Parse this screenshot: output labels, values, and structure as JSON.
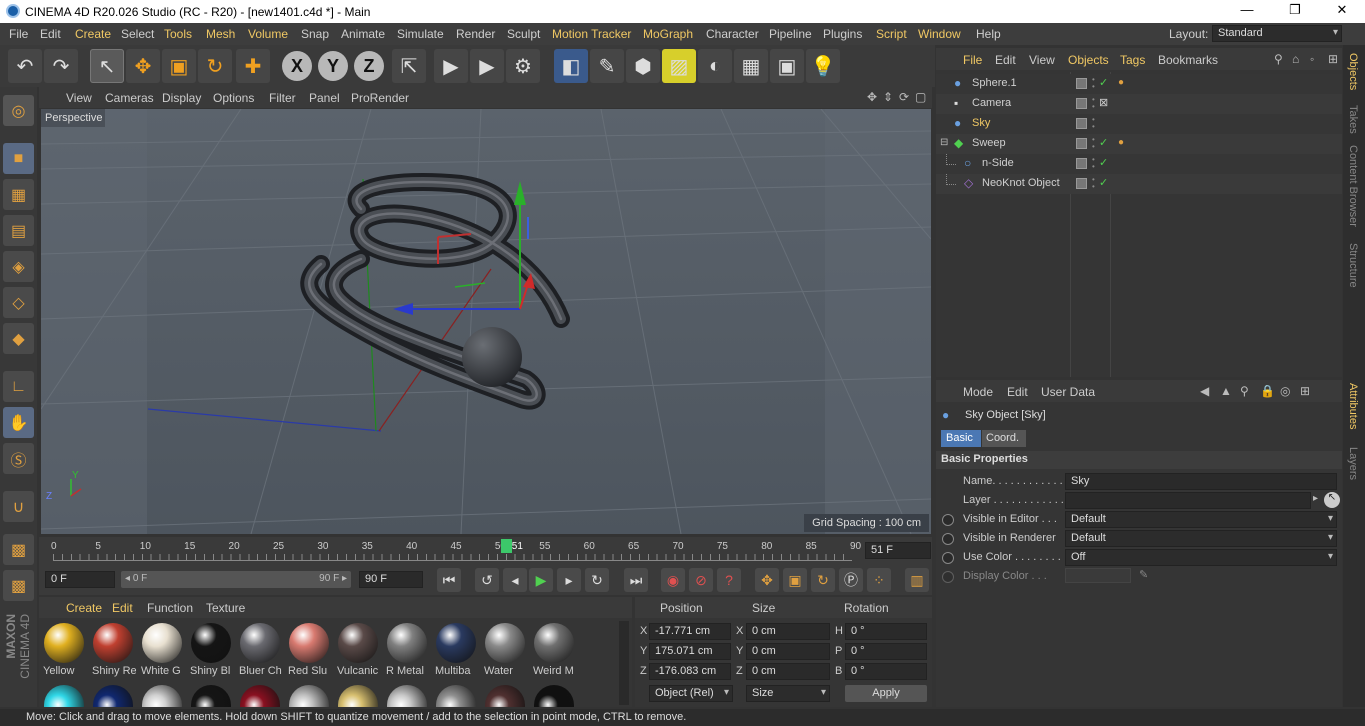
{
  "window": {
    "title": "CINEMA 4D R20.026 Studio (RC - R20) - [new1401.c4d *] - Main",
    "controls": {
      "minimize": "—",
      "maximize": "❐",
      "close": "✕"
    }
  },
  "menu": {
    "items": [
      "File",
      "Edit",
      "Create",
      "Select",
      "Tools",
      "Mesh",
      "Volume",
      "Snap",
      "Animate",
      "Simulate",
      "Render",
      "Sculpt",
      "Motion Tracker",
      "MoGraph",
      "Character",
      "Pipeline",
      "Plugins",
      "Script",
      "Window",
      "Help"
    ],
    "highlighted": [
      "Create",
      "Tools",
      "Mesh",
      "Volume",
      "Motion Tracker",
      "MoGraph",
      "Script",
      "Window"
    ],
    "layout_label": "Layout:",
    "layout_value": "Standard"
  },
  "toolbar": {
    "icons": [
      "undo-icon",
      "redo-icon",
      "select-arrow-icon",
      "move-icon",
      "scale-icon",
      "rotate-icon",
      "transform-icon",
      "x-axis-icon",
      "y-axis-icon",
      "z-axis-icon",
      "coordinate-system-icon",
      "render-view-icon",
      "render-picture-viewer-icon",
      "edit-render-settings-icon",
      "cube-object-icon",
      "pen-spline-icon",
      "subdivision-surface-icon",
      "cloner-icon",
      "deformer-icon",
      "floor-icon",
      "camera-icon",
      "light-icon"
    ],
    "axis_labels": [
      "X",
      "Y",
      "Z"
    ]
  },
  "viewport": {
    "menu": [
      "View",
      "Cameras",
      "Display",
      "Options",
      "Filter",
      "Panel",
      "ProRender"
    ],
    "label": "Perspective",
    "grid_spacing": "Grid Spacing : 100 cm",
    "axis_y": "Y",
    "axis_z": "Z"
  },
  "timeline": {
    "ticks": [
      "0",
      "5",
      "10",
      "15",
      "20",
      "25",
      "30",
      "35",
      "40",
      "45",
      "50",
      "55",
      "60",
      "65",
      "70",
      "75",
      "80",
      "85",
      "90"
    ],
    "current_frame": "51",
    "current_frame_fraction": 0.5667,
    "end_field": "51 F",
    "start_field": "0 F",
    "range_start": "0 F",
    "range_end": "90 F",
    "max_field": "90 F"
  },
  "objects_manager": {
    "menu": [
      "File",
      "Edit",
      "View",
      "Objects",
      "Tags",
      "Bookmarks"
    ],
    "highlighted": [
      "File",
      "Objects",
      "Tags"
    ],
    "rows": [
      {
        "name": "Sphere.1",
        "icon": "sphere-icon",
        "indent": 0,
        "highlight": false,
        "check": true,
        "tag": true
      },
      {
        "name": "Camera",
        "icon": "camera-icon",
        "indent": 0,
        "highlight": false,
        "check": false,
        "tag": false
      },
      {
        "name": "Sky",
        "icon": "sky-icon",
        "indent": 0,
        "highlight": true,
        "check": false,
        "tag": false
      },
      {
        "name": "Sweep",
        "icon": "sweep-icon",
        "indent": 0,
        "highlight": false,
        "check": true,
        "tag": true
      },
      {
        "name": "n-Side",
        "icon": "nside-spline-icon",
        "indent": 1,
        "highlight": false,
        "check": true,
        "tag": false
      },
      {
        "name": "NeoKnot Object",
        "icon": "spline-icon",
        "indent": 1,
        "highlight": false,
        "check": true,
        "tag": false
      }
    ]
  },
  "attributes": {
    "menu": [
      "Mode",
      "Edit",
      "User Data"
    ],
    "object_title": "Sky Object [Sky]",
    "tabs": [
      "Basic",
      "Coord."
    ],
    "section": "Basic Properties",
    "fields": [
      {
        "label": "Name. . . . . . . . . . . .",
        "value": "Sky"
      },
      {
        "label": "Layer . . . . . . . . . . . .",
        "value": ""
      },
      {
        "label": "Visible in Editor . . .",
        "value": "Default"
      },
      {
        "label": "Visible in Renderer",
        "value": "Default"
      },
      {
        "label": "Use Color . . . . . . . .",
        "value": "Off"
      },
      {
        "label": "Display Color . . .",
        "value": ""
      }
    ]
  },
  "material_manager": {
    "menu": [
      "Create",
      "Edit",
      "Function",
      "Texture"
    ],
    "highlighted": [
      "Create",
      "Edit"
    ],
    "materials": [
      {
        "label": "Yellow",
        "color": "#e0b020"
      },
      {
        "label": "Shiny Re",
        "color": "#c04030"
      },
      {
        "label": "White G",
        "color": "#e8e0d0"
      },
      {
        "label": "Shiny Bl",
        "color": "#151515"
      },
      {
        "label": "Bluer Ch",
        "color": "#6a6a70"
      },
      {
        "label": "Red Slu",
        "color": "#d87a70"
      },
      {
        "label": "Vulcanic",
        "color": "#5a4a48"
      },
      {
        "label": "R Metal",
        "color": "#808080"
      },
      {
        "label": "Multiba",
        "color": "#2a3a60"
      },
      {
        "label": "Water",
        "color": "#8a8a8a"
      },
      {
        "label": "Weird M",
        "color": "#707070"
      }
    ],
    "second_row_colors": [
      "#30d8e8",
      "#102870",
      "#d0d0d0",
      "#151515",
      "#8a1020",
      "#c0c0c0",
      "#d8c070",
      "#c8c8c8",
      "#909090",
      "#503030",
      "#101010"
    ]
  },
  "coordinates": {
    "headers": [
      "Position",
      "Size",
      "Rotation"
    ],
    "rows": [
      {
        "axis": "X",
        "pos": "-17.771 cm",
        "size_axis": "X",
        "size": "0 cm",
        "rot_axis": "H",
        "rot": "0 °"
      },
      {
        "axis": "Y",
        "pos": "175.071 cm",
        "size_axis": "Y",
        "size": "0 cm",
        "rot_axis": "P",
        "rot": "0 °"
      },
      {
        "axis": "Z",
        "pos": "-176.083 cm",
        "size_axis": "Z",
        "size": "0 cm",
        "rot_axis": "B",
        "rot": "0 °"
      }
    ],
    "mode": "Object (Rel)",
    "size_mode": "Size",
    "apply": "Apply"
  },
  "right_tabs": [
    "Objects",
    "Takes",
    "Content Browser",
    "Structure",
    "Attributes",
    "Layers"
  ],
  "status": "Move: Click and drag to move elements. Hold down SHIFT to quantize movement / add to the selection in point mode, CTRL to remove.",
  "brand": {
    "maxon": "MAXON",
    "cinema": "CINEMA 4D"
  }
}
